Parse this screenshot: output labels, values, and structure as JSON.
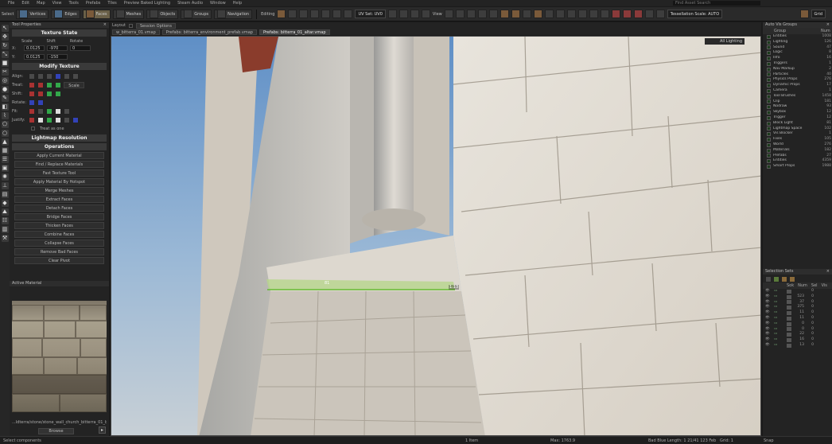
{
  "menu": [
    "File",
    "Edit",
    "Map",
    "View",
    "Tools",
    "Prefabs",
    "Tiles",
    "Preview Baked Lighting",
    "Steam Audio",
    "Window",
    "Help"
  ],
  "search_placeholder": "Find Asset Search",
  "toolbar": {
    "select_label": "Select",
    "vertices": "Vertices",
    "edges": "Edges",
    "faces": "Faces",
    "meshes": "Meshes",
    "objects": "Objects",
    "groups": "Groups",
    "navigation": "Navigation",
    "editing_label": "Editing",
    "uv_set": "UV Set: UV0",
    "view_label": "View",
    "tessellation": "Tessellation Scale: AUTO",
    "grid_value": "Grid"
  },
  "left_panel": {
    "title": "Tool Properties",
    "texture_state": "Texture State",
    "col_scale": "Scale",
    "col_shift": "Shift",
    "col_rotate": "Rotate",
    "x_label": "X:",
    "y_label": "Y:",
    "scale_x": "0.0125",
    "scale_y": "0.0125",
    "shift_x": "-970",
    "shift_y": "-150",
    "rotate": "0",
    "modify_texture": "Modify Texture",
    "align": "Align:",
    "treat": "Treat:",
    "shift": "Shift:",
    "rotate_lbl": "Rotate:",
    "fit": "Fit:",
    "justify": "Justify:",
    "scale_btn": "Scale",
    "treat_as_one": "Treat as one",
    "lightmap_resolution": "Lightmap Resolution",
    "operations": "Operations",
    "ops": [
      "Apply Current Material",
      "Find / Replace Materials",
      "Fast Texture Tool",
      "Apply Material By Hotspot",
      "Merge Meshes",
      "Extract Faces",
      "Detach Faces",
      "Bridge Faces",
      "Thicken Faces",
      "Combine Faces",
      "Collapse Faces",
      "Remove Bad Faces",
      "Clear Pivot"
    ],
    "active_material": "Active Material",
    "material_path": "...ldterra/stone/stone_wall_church_bitterra_01_blend.vmat",
    "browse": "Browse"
  },
  "viewport": {
    "layout_label": "Layout",
    "session_options": "Session Options",
    "tabs": [
      "w_bitterra_01.vmap",
      "Prefabs: bitterra_environment_prefab.vmap",
      "Prefabs: bitterra_01_altar.vmap"
    ],
    "lighting_mode": "All Lighting",
    "dim_a": "81",
    "dim_b": "1.13"
  },
  "visgroups": {
    "title": "Auto Vis Groups",
    "col_group": "Group",
    "col_num": "Num",
    "rows": [
      {
        "name": "Entities",
        "num": "1008"
      },
      {
        "name": "Lighting",
        "num": "126"
      },
      {
        "name": "Sound",
        "num": "47"
      },
      {
        "name": "Logic",
        "num": "8"
      },
      {
        "name": "Info",
        "num": "16"
      },
      {
        "name": "Triggers",
        "num": "1"
      },
      {
        "name": "Nav Markup",
        "num": "2"
      },
      {
        "name": "Particles",
        "num": "40"
      },
      {
        "name": "Physics Props",
        "num": "276"
      },
      {
        "name": "Dynamic Props",
        "num": "17"
      },
      {
        "name": "Camera",
        "num": "1"
      },
      {
        "name": "Tool Brushes",
        "num": "1458"
      },
      {
        "name": "  Clip",
        "num": "181"
      },
      {
        "name": "  Nodraw",
        "num": "93"
      },
      {
        "name": "  Skybox",
        "num": "12"
      },
      {
        "name": "  Trigger",
        "num": "12"
      },
      {
        "name": "  Block Light",
        "num": "81"
      },
      {
        "name": "  Lightmap Space",
        "num": "102"
      },
      {
        "name": "  Vis Blocker",
        "num": "1"
      },
      {
        "name": "  Fixes",
        "num": "105"
      },
      {
        "name": "World",
        "num": "276"
      },
      {
        "name": "Materials",
        "num": "182"
      },
      {
        "name": "Prefabs",
        "num": "27"
      },
      {
        "name": "Entities",
        "num": "4359"
      },
      {
        "name": "Smart Props",
        "num": "1988"
      }
    ]
  },
  "selection_sets": {
    "title": "Selection Sets",
    "cols": [
      "Sok",
      "Num",
      "Sel",
      "Vis"
    ],
    "rows": [
      {
        "num": "",
        "sel": "0"
      },
      {
        "num": "523",
        "sel": "0"
      },
      {
        "num": "37",
        "sel": "0"
      },
      {
        "num": "375",
        "sel": "0"
      },
      {
        "num": "11",
        "sel": "0"
      },
      {
        "num": "11",
        "sel": "0"
      },
      {
        "num": "0",
        "sel": "0"
      },
      {
        "num": "0",
        "sel": "0"
      },
      {
        "num": "22",
        "sel": "0"
      },
      {
        "num": "16",
        "sel": "0"
      },
      {
        "num": "13",
        "sel": "0"
      }
    ]
  },
  "status": {
    "left": "Select components",
    "items": "1 Item",
    "max": "Max: 1763.9",
    "block_length": "Bad Blue Length: 1 21/41 123 Feb",
    "grid": "Grid: 1",
    "snap": "Snap"
  }
}
